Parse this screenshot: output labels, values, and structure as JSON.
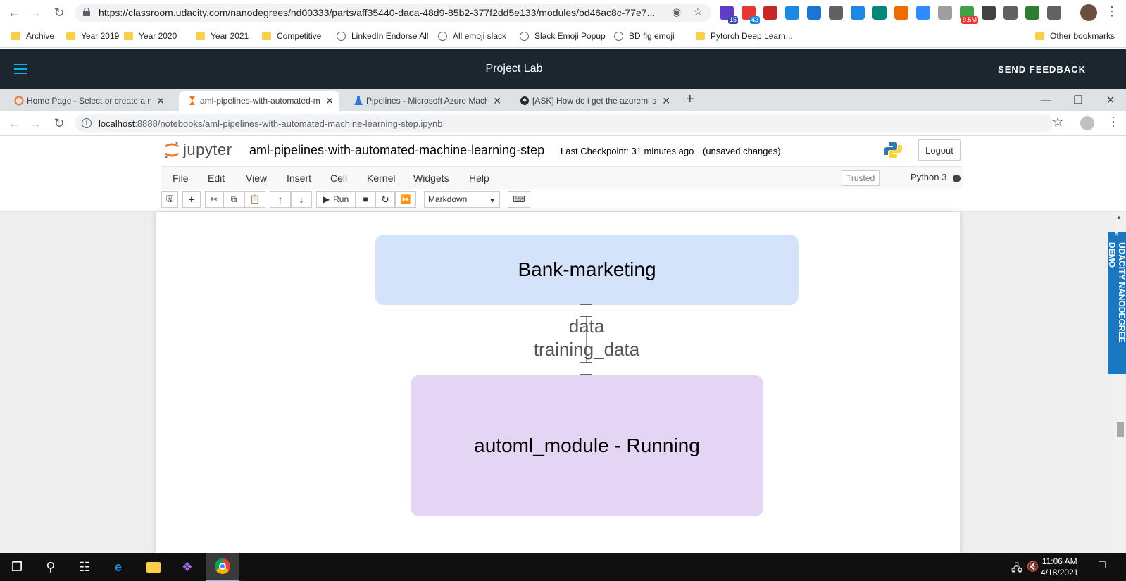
{
  "outer_browser": {
    "url": "https://classroom.udacity.com/nanodegrees/nd00333/parts/aff35440-daca-48d9-85b2-377f2dd5e133/modules/bd46ac8c-77e7...",
    "extensions": [
      {
        "name": "graduation-cap-icon",
        "color": "#5f3dc4",
        "badge": "15",
        "badge_color": "#3949ab"
      },
      {
        "name": "calendar-icon",
        "color": "#e53935",
        "badge": "42",
        "badge_color": "#1e88e5"
      },
      {
        "name": "bookmark-icon",
        "color": "#c62828"
      },
      {
        "name": "translate-icon",
        "color": "#1e88e5"
      },
      {
        "name": "window-icon",
        "color": "#1976d2"
      },
      {
        "name": "camera-icon",
        "color": "#616161"
      },
      {
        "name": "drop-icon",
        "color": "#1e88e5"
      },
      {
        "name": "refresh-ext-icon",
        "color": "#00897b"
      },
      {
        "name": "orange-ext-icon",
        "color": "#ef6c00"
      },
      {
        "name": "zoom-icon",
        "color": "#2d8cff"
      },
      {
        "name": "shield-icon",
        "color": "#9e9e9e"
      },
      {
        "name": "meter-icon",
        "color": "#43a047",
        "badge": "9.5M",
        "badge_color": "#e53935"
      },
      {
        "name": "code-icon",
        "color": "#424242"
      },
      {
        "name": "bike-icon",
        "color": "#616161"
      },
      {
        "name": "check-icon",
        "color": "#2e7d32"
      },
      {
        "name": "puzzle-icon",
        "color": "#5f6368"
      }
    ]
  },
  "bookmarks": {
    "items": [
      {
        "label": "Archive",
        "type": "folder"
      },
      {
        "label": "Year 2019",
        "type": "folder"
      },
      {
        "label": "Year 2020",
        "type": "folder"
      },
      {
        "label": "Year 2021",
        "type": "folder"
      },
      {
        "label": "Competitive",
        "type": "folder"
      },
      {
        "label": "LinkedIn Endorse All",
        "type": "link"
      },
      {
        "label": "All emoji slack",
        "type": "link"
      },
      {
        "label": "Slack Emoji Popup",
        "type": "link"
      },
      {
        "label": "BD flg emoji",
        "type": "link"
      },
      {
        "label": "Pytorch Deep Learn...",
        "type": "folder"
      }
    ],
    "other": "Other bookmarks"
  },
  "udacity": {
    "title": "Project Lab",
    "feedback": "SEND FEEDBACK",
    "side_tab": "UDACITY NANODEGREE DEMO"
  },
  "inner_tabs": [
    {
      "label": "Home Page - Select or create a notebook",
      "active": false
    },
    {
      "label": "aml-pipelines-with-automated-machine-learning-step",
      "active": true
    },
    {
      "label": "Pipelines - Microsoft Azure Machine Learning",
      "active": false
    },
    {
      "label": "[ASK] How do i get the azureml sdk",
      "active": false
    }
  ],
  "inner_browser": {
    "url_host": "localhost",
    "url_rest": ":8888/notebooks/aml-pipelines-with-automated-machine-learning-step.ipynb"
  },
  "jupyter": {
    "logo_text": "jupyter",
    "notebook_name": "aml-pipelines-with-automated-machine-learning-step",
    "checkpoint": "Last Checkpoint: 31 minutes ago",
    "unsaved": "(unsaved changes)",
    "logout": "Logout",
    "menus": [
      "File",
      "Edit",
      "View",
      "Insert",
      "Cell",
      "Kernel",
      "Widgets",
      "Help"
    ],
    "trusted": "Trusted",
    "kernel": "Python 3",
    "run_label": "Run",
    "cell_type": "Markdown"
  },
  "pipeline": {
    "source_node": "Bank-marketing",
    "edge_labels": [
      "data",
      "training_data"
    ],
    "target_node": "automl_module - Running"
  },
  "taskbar": {
    "time": "11:06 AM",
    "date": "4/18/2021"
  }
}
